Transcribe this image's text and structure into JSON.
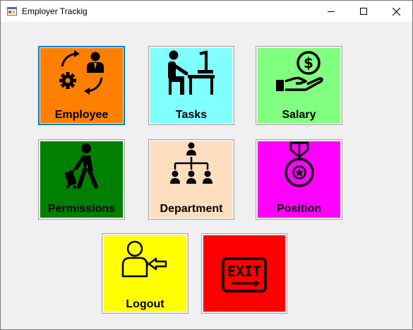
{
  "window": {
    "title": "Employer Trackig"
  },
  "tiles": {
    "employee": {
      "label": "Employee",
      "color": "#ff8000",
      "icon": "employee-cycle-icon"
    },
    "tasks": {
      "label": "Tasks",
      "color": "#80ffff",
      "icon": "person-at-desk-icon"
    },
    "salary": {
      "label": "Salary",
      "color": "#80ff80",
      "icon": "hand-with-coin-icon"
    },
    "permissions": {
      "label": "Permissions",
      "color": "#008000",
      "icon": "traveler-with-luggage-icon"
    },
    "department": {
      "label": "Department",
      "color": "#ffdec0",
      "icon": "org-chart-icon"
    },
    "position": {
      "label": "Position",
      "color": "#ff00ff",
      "icon": "medal-icon"
    },
    "logout": {
      "label": "Logout",
      "color": "#ffff00",
      "icon": "user-logout-icon"
    },
    "exit": {
      "label": "",
      "color": "#ff0000",
      "icon": "exit-sign-icon",
      "sign_text": "EXIT"
    }
  }
}
